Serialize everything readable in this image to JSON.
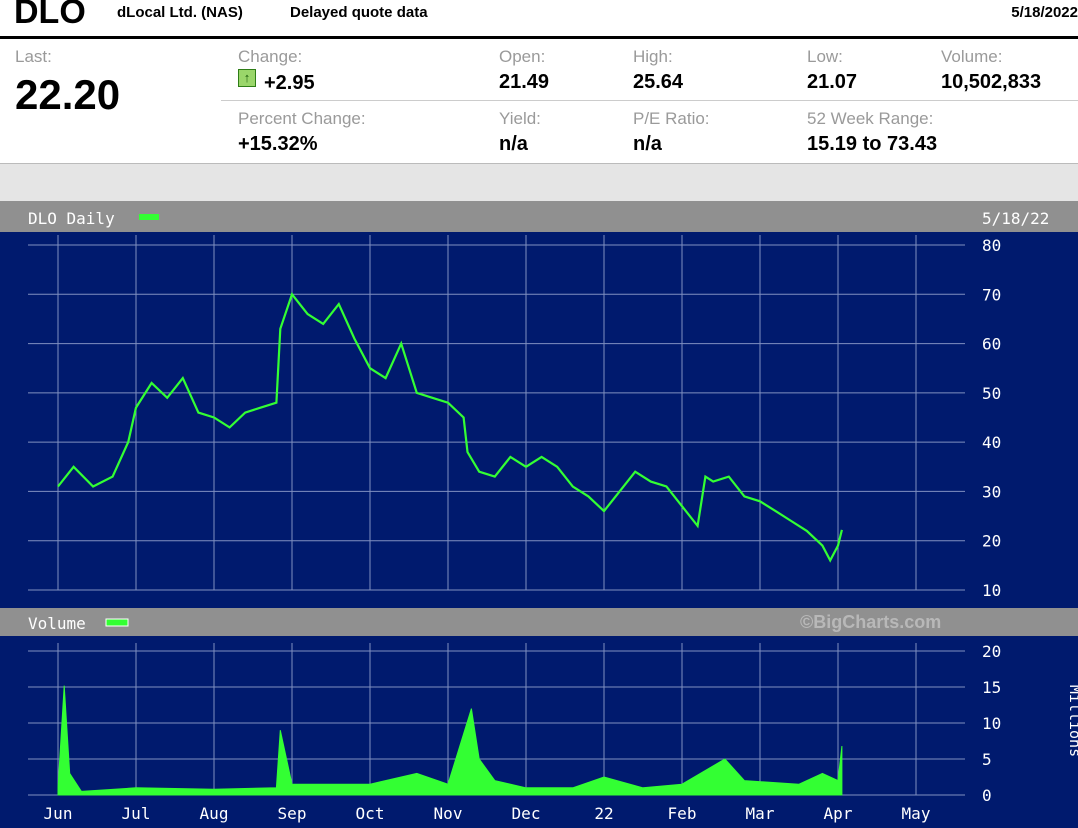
{
  "header": {
    "symbol": "DLO",
    "company": "dLocal Ltd. (NAS)",
    "delay_note": "Delayed quote data",
    "date": "5/18/2022"
  },
  "quote": {
    "last_label": "Last:",
    "last_value": "22.20",
    "change_label": "Change:",
    "change_value": "+2.95",
    "percent_change_label": "Percent Change:",
    "percent_change_value": "+15.32%",
    "open_label": "Open:",
    "open_value": "21.49",
    "high_label": "High:",
    "high_value": "25.64",
    "low_label": "Low:",
    "low_value": "21.07",
    "volume_label": "Volume:",
    "volume_value": "10,502,833",
    "yield_label": "Yield:",
    "yield_value": "n/a",
    "pe_label": "P/E Ratio:",
    "pe_value": "n/a",
    "range_label": "52 Week Range:",
    "range_value": "15.19 to 73.43",
    "up_icon": "arrow-up-icon"
  },
  "chart_data": {
    "type": "line",
    "title": "DLO Daily",
    "date_label": "5/18/22",
    "watermark": "©BigCharts.com",
    "background": "#001a6e",
    "line_color": "#33ff33",
    "grid_color": "#8090c0",
    "months": [
      "Jun",
      "Jul",
      "Aug",
      "Sep",
      "Oct",
      "Nov",
      "Dec",
      "22",
      "Feb",
      "Mar",
      "Apr",
      "May"
    ],
    "price": {
      "ylim": [
        10,
        80
      ],
      "yticks": [
        "80",
        "70",
        "60",
        "50",
        "40",
        "30",
        "20",
        "10"
      ],
      "points": [
        [
          0.0,
          31
        ],
        [
          0.2,
          35
        ],
        [
          0.45,
          31
        ],
        [
          0.7,
          33
        ],
        [
          0.9,
          40
        ],
        [
          1.0,
          47
        ],
        [
          1.2,
          52
        ],
        [
          1.4,
          49
        ],
        [
          1.6,
          53
        ],
        [
          1.8,
          46
        ],
        [
          2.0,
          45
        ],
        [
          2.2,
          43
        ],
        [
          2.4,
          46
        ],
        [
          2.6,
          47
        ],
        [
          2.8,
          48
        ],
        [
          2.85,
          63
        ],
        [
          3.0,
          70
        ],
        [
          3.2,
          66
        ],
        [
          3.4,
          64
        ],
        [
          3.6,
          68
        ],
        [
          3.8,
          61
        ],
        [
          4.0,
          55
        ],
        [
          4.2,
          53
        ],
        [
          4.4,
          60
        ],
        [
          4.6,
          50
        ],
        [
          4.8,
          49
        ],
        [
          5.0,
          48
        ],
        [
          5.2,
          45
        ],
        [
          5.25,
          38
        ],
        [
          5.4,
          34
        ],
        [
          5.6,
          33
        ],
        [
          5.8,
          37
        ],
        [
          6.0,
          35
        ],
        [
          6.2,
          37
        ],
        [
          6.4,
          35
        ],
        [
          6.6,
          31
        ],
        [
          6.8,
          29
        ],
        [
          7.0,
          26
        ],
        [
          7.2,
          30
        ],
        [
          7.4,
          34
        ],
        [
          7.6,
          32
        ],
        [
          7.8,
          31
        ],
        [
          8.0,
          27
        ],
        [
          8.2,
          23
        ],
        [
          8.3,
          33
        ],
        [
          8.4,
          32
        ],
        [
          8.6,
          33
        ],
        [
          8.8,
          29
        ],
        [
          9.0,
          28
        ],
        [
          9.2,
          26
        ],
        [
          9.4,
          24
        ],
        [
          9.6,
          22
        ],
        [
          9.8,
          19
        ],
        [
          9.9,
          16
        ],
        [
          10.0,
          19
        ],
        [
          10.05,
          22.2
        ]
      ]
    },
    "volume": {
      "unit_label": "Millions",
      "label": "Volume",
      "ylim": [
        0,
        20
      ],
      "yticks": [
        "20",
        "15",
        "10",
        "5",
        "0"
      ],
      "points": [
        [
          0.0,
          1
        ],
        [
          0.08,
          15.2
        ],
        [
          0.15,
          3
        ],
        [
          0.3,
          0.5
        ],
        [
          1.0,
          1
        ],
        [
          2.0,
          0.8
        ],
        [
          2.8,
          1
        ],
        [
          2.85,
          9
        ],
        [
          3.0,
          1.5
        ],
        [
          3.5,
          1.5
        ],
        [
          4.0,
          1.5
        ],
        [
          4.6,
          3
        ],
        [
          5.0,
          1.5
        ],
        [
          5.3,
          12
        ],
        [
          5.4,
          5
        ],
        [
          5.6,
          2
        ],
        [
          6.0,
          1
        ],
        [
          6.6,
          1
        ],
        [
          7.0,
          2.5
        ],
        [
          7.5,
          1
        ],
        [
          8.0,
          1.5
        ],
        [
          8.55,
          5
        ],
        [
          8.8,
          2
        ],
        [
          9.5,
          1.5
        ],
        [
          9.8,
          3
        ],
        [
          10.0,
          2
        ],
        [
          10.05,
          6.8
        ]
      ]
    }
  }
}
